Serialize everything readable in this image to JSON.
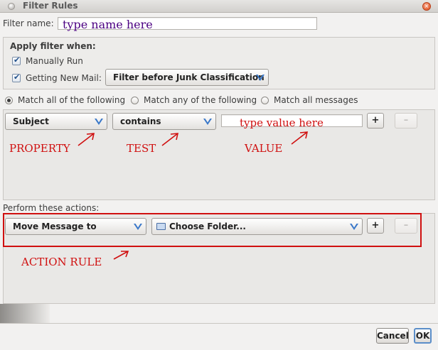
{
  "window": {
    "title": "Filter Rules",
    "close_glyph": "×"
  },
  "filter_name": {
    "label": "Filter name:",
    "value": "type name here",
    "value_color": "#4b0082"
  },
  "apply_when": {
    "heading": "Apply filter when:",
    "manually_run": {
      "label": "Manually Run",
      "checked": true
    },
    "getting_new_mail": {
      "label": "Getting New Mail:",
      "checked": true
    },
    "timing_select": "Filter before Junk Classification"
  },
  "match_options": [
    {
      "label": "Match all of the following",
      "selected": true
    },
    {
      "label": "Match any of the following",
      "selected": false
    },
    {
      "label": "Match all messages",
      "selected": false
    }
  ],
  "rule": {
    "property": "Subject",
    "test": "contains",
    "value_placeholder": "type value here",
    "add": "+",
    "remove": "–"
  },
  "rule_annotations": {
    "property": "PROPERTY",
    "test": "TEST",
    "value": "VALUE"
  },
  "actions": {
    "label": "Perform these actions:",
    "action": "Move Message to",
    "folder": "Choose Folder...",
    "add": "+",
    "remove": "–",
    "annotation": "ACTION RULE"
  },
  "buttons": {
    "cancel": "Cancel",
    "ok": "OK"
  },
  "colors": {
    "annotation_red": "#d01010",
    "dropdown_arrow": "#3a78c9"
  }
}
